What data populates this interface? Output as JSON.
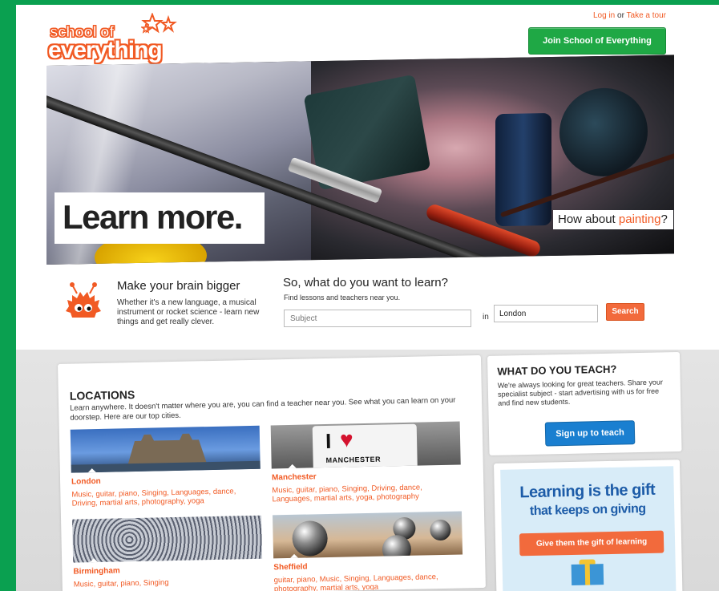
{
  "header": {
    "logo_line1": "school of",
    "logo_line2": "everything",
    "login_label": "Log in",
    "or_text": " or ",
    "tour_label": "Take a tour",
    "join_label": "Join School of Everything"
  },
  "hero": {
    "headline": "Learn more.",
    "prompt_prefix": "How about ",
    "prompt_subject": "painting",
    "prompt_suffix": "?"
  },
  "intro": {
    "title": "Make your brain bigger",
    "description": "Whether it's a new language, a musical instrument or rocket science - learn new things and get really clever."
  },
  "search": {
    "title": "So, what do you want to learn?",
    "subtitle": "Find lessons and teachers near you.",
    "subject_placeholder": "Subject",
    "in_label": "in",
    "location_value": "London",
    "button_label": "Search"
  },
  "locations": {
    "title": "LOCATIONS",
    "description": "Learn anywhere. It doesn't matter where you are, you can find a teacher near you. See what you can learn on your doorstep. Here are our top cities.",
    "cities": [
      {
        "name": "London",
        "tags": "Music, guitar, piano, Singing, Languages, dance, Driving, martial arts, photography, yoga"
      },
      {
        "name": "Manchester",
        "tags": "Music, guitar, piano, Singing, Driving, dance, Languages, martial arts, yoga, photography"
      },
      {
        "name": "Birmingham",
        "tags": "Music, guitar, piano, Singing"
      },
      {
        "name": "Sheffield",
        "tags": "guitar, piano, Music, Singing, Languages, dance, photography, martial arts, yoga"
      }
    ],
    "manchester_mug_word": "MANCHESTER",
    "manchester_mug_i": "I"
  },
  "teach": {
    "title": "WHAT DO YOU TEACH?",
    "description": "We're always looking for great teachers. Share your specialist subject - start advertising with us for free and find new students.",
    "button_label": "Sign up to teach"
  },
  "gift": {
    "title_line1": "Learning is the gift",
    "title_line2": "that keeps on giving",
    "button_label": "Give them the gift of learning"
  },
  "colors": {
    "frame_green": "#0aa050",
    "brand_orange": "#f15a24",
    "join_green": "#1fa845",
    "teach_blue": "#1a7fd0",
    "gift_blue": "#1d5ca8"
  }
}
